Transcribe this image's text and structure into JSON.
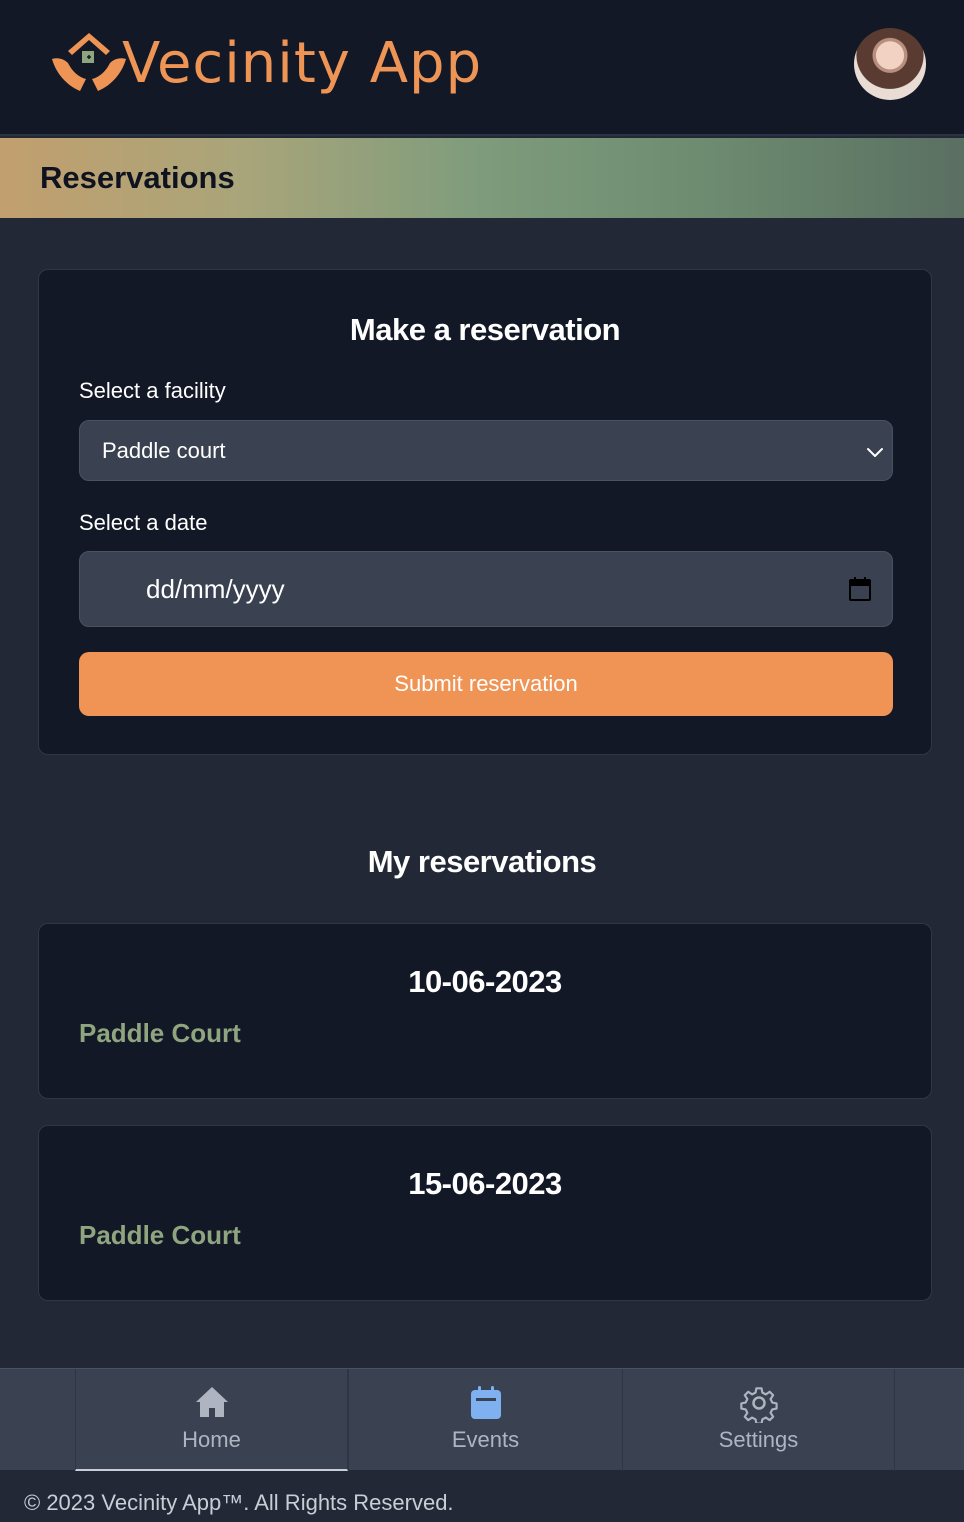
{
  "header": {
    "app_name": "Vecinity App",
    "logo_icon": "hands-house-icon",
    "avatar_alt": "User avatar"
  },
  "page": {
    "title": "Reservations"
  },
  "form": {
    "title": "Make a reservation",
    "facility_label": "Select a facility",
    "facility_value": "Paddle court",
    "date_label": "Select a date",
    "date_placeholder": "dd/mm/yyyy",
    "submit_label": "Submit reservation"
  },
  "reservations": {
    "title": "My reservations",
    "items": [
      {
        "date": "10-06-2023",
        "facility": "Paddle Court"
      },
      {
        "date": "15-06-2023",
        "facility": "Paddle Court"
      }
    ]
  },
  "nav": {
    "items": [
      {
        "label": "Home",
        "icon": "home-icon"
      },
      {
        "label": "Events",
        "icon": "calendar-icon"
      },
      {
        "label": "Settings",
        "icon": "gear-icon"
      }
    ]
  },
  "footer": {
    "text": "© 2023 Vecinity App™. All Rights Reserved."
  },
  "colors": {
    "accent": "#ef9455",
    "facility_text": "#8fa57f",
    "background": "#222836",
    "card": "#131826",
    "events_icon": "#7fb0f0"
  }
}
